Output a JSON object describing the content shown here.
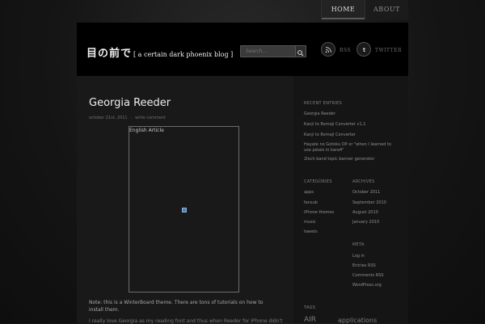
{
  "nav": {
    "items": [
      {
        "label": "HOME",
        "active": true
      },
      {
        "label": "ABOUT",
        "active": false
      }
    ]
  },
  "header": {
    "logo_jp": "目の前で",
    "logo_sub": "[ a certain dark phoenix blog ]",
    "search_placeholder": "Search...",
    "rss_label": "RSS",
    "twitter_label": "TWITTER"
  },
  "post": {
    "title": "Georgia Reeder",
    "date": "october 21st, 2011",
    "comments": "write comment",
    "frame_label": "English Article",
    "note": "Note: this is a WinterBoard theme. There are tons of tutorials on how to install them.",
    "cut_line": "I really love Georgia as my reading font and thus when Reeder for iPhone didn't"
  },
  "sidebar": {
    "recent_heading": "RECENT ENTRIES",
    "recent": [
      "Georgia Reeder",
      "Kanji to Romaji Converter v1.1",
      "Kanji to Romaji Converter",
      "Hayate no Gotoku OP or \"when I learned to use pstals in kara4\"",
      "2Ioch band topic banner generator"
    ],
    "categories_heading": "CATEGORIES",
    "categories": [
      "apps",
      "fansub",
      "iPhone themes",
      "music",
      "tweets"
    ],
    "archives_heading": "ARCHIVES",
    "archives": [
      "October 2011",
      "September 2010",
      "August 2010",
      "January 2010"
    ],
    "meta_heading": "META",
    "meta": [
      "Log in",
      "Entries RSS",
      "Comments RSS",
      "WordPress.org"
    ],
    "tags_heading": "TAGS",
    "tags": [
      "AIR",
      "applications"
    ]
  },
  "colors": {
    "background": "#141414",
    "header_bg": "#000000",
    "content_bg": "#191919",
    "sidebar_bg": "#151515",
    "title": "#ededed"
  }
}
